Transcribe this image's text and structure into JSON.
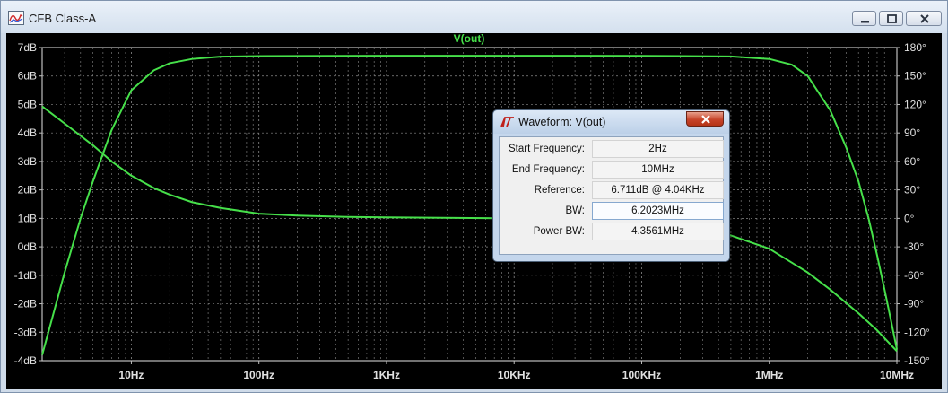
{
  "window": {
    "title": "CFB Class-A",
    "app_icon": "waveform-app-icon",
    "buttons": [
      "minimize-icon",
      "restore-icon",
      "close-icon"
    ]
  },
  "plot": {
    "trace_title": "V(out)",
    "colors": {
      "background": "#000000",
      "trace": "#46e04a",
      "grid": "#8a8a8a",
      "labels": "#e0e0e0",
      "title": "#46e04a"
    }
  },
  "chart_data": {
    "type": "line",
    "title": "V(out)",
    "x_scale": "log",
    "xlim": [
      2,
      10000000
    ],
    "x_ticks": [
      "10Hz",
      "100Hz",
      "1KHz",
      "10KHz",
      "100KHz",
      "1MHz",
      "10MHz"
    ],
    "x_tick_values": [
      10,
      100,
      1000,
      10000,
      100000,
      1000000,
      10000000
    ],
    "ylim_left": [
      -4,
      7
    ],
    "y_ticks_left": [
      "7dB",
      "6dB",
      "5dB",
      "4dB",
      "3dB",
      "2dB",
      "1dB",
      "0dB",
      "-1dB",
      "-2dB",
      "-3dB",
      "-4dB"
    ],
    "y_tick_values_left": [
      7,
      6,
      5,
      4,
      3,
      2,
      1,
      0,
      -1,
      -2,
      -3,
      -4
    ],
    "ylim_right": [
      -150,
      180
    ],
    "y_ticks_right": [
      "180°",
      "150°",
      "120°",
      "90°",
      "60°",
      "30°",
      "0°",
      "-30°",
      "-60°",
      "-90°",
      "-120°",
      "-150°"
    ],
    "y_tick_values_right": [
      180,
      150,
      120,
      90,
      60,
      30,
      0,
      -30,
      -60,
      -90,
      -120,
      -150
    ],
    "grid": true,
    "series": [
      {
        "name": "V(out) magnitude",
        "axis": "left",
        "x": [
          2,
          3,
          4,
          5,
          7,
          10,
          15,
          20,
          30,
          50,
          100,
          1000,
          10000,
          100000,
          500000,
          1000000,
          1500000,
          2000000,
          3000000,
          4000000,
          5000000,
          6000000,
          7000000,
          8000000,
          9000000,
          10000000
        ],
        "values": [
          -3.8,
          -0.9,
          1.0,
          2.3,
          4.1,
          5.5,
          6.2,
          6.45,
          6.6,
          6.68,
          6.7,
          6.711,
          6.711,
          6.71,
          6.69,
          6.6,
          6.4,
          6.0,
          4.8,
          3.5,
          2.3,
          1.0,
          -0.3,
          -1.5,
          -2.6,
          -3.6
        ]
      },
      {
        "name": "V(out) phase",
        "axis": "right",
        "x": [
          2,
          3,
          5,
          7,
          10,
          15,
          20,
          30,
          50,
          100,
          200,
          500,
          1000,
          10000,
          100000,
          300000,
          500000,
          1000000,
          2000000,
          3000000,
          5000000,
          7000000,
          10000000
        ],
        "values": [
          118,
          100,
          77,
          60,
          45,
          32,
          25,
          17,
          11,
          5,
          3,
          1.5,
          1,
          0,
          -5,
          -12,
          -18,
          -32,
          -57,
          -75,
          -100,
          -118,
          -140
        ]
      }
    ]
  },
  "dialog": {
    "title": "Waveform: V(out)",
    "icon": "lt-logo-icon",
    "close_icon": "close-icon",
    "rows": [
      {
        "label": "Start Frequency:",
        "value": "2Hz"
      },
      {
        "label": "End Frequency:",
        "value": "10MHz"
      },
      {
        "label": "Reference:",
        "value": "6.711dB @ 4.04KHz"
      },
      {
        "label": "BW:",
        "value": "6.2023MHz"
      },
      {
        "label": "Power BW:",
        "value": "4.3561MHz"
      }
    ]
  }
}
